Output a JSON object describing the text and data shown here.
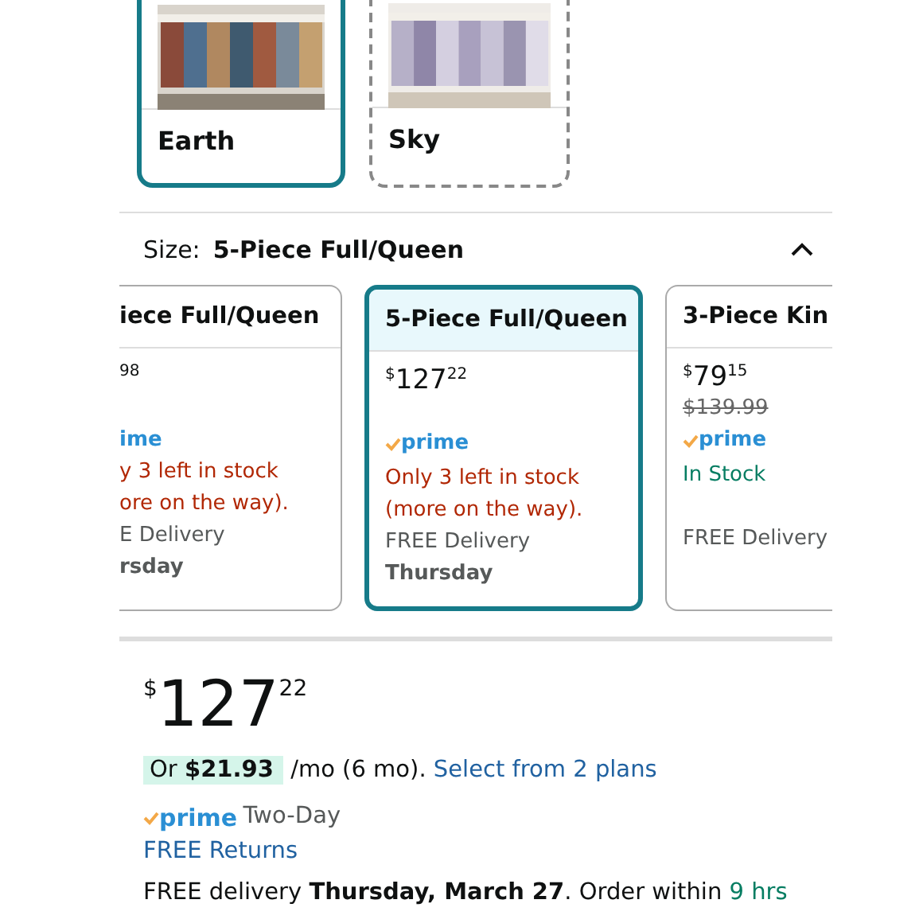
{
  "color_swatches": [
    {
      "label": "Earth",
      "selected": true,
      "available": true,
      "kind": "picture"
    },
    {
      "label": "Sky",
      "selected": false,
      "available": false,
      "kind": "picture"
    }
  ],
  "size": {
    "label": "Size:",
    "value": "5-Piece Full/Queen",
    "expanded": true
  },
  "size_options": [
    {
      "title": "iece Full/Queen",
      "price_fraction": "98",
      "prime": "ime",
      "prime_check": false,
      "stock": "y 3 left in stock",
      "stock_more": "ore on the way).",
      "in_stock": false,
      "delivery": "E Delivery",
      "delivery_day": "rsday",
      "selected": false
    },
    {
      "title": "5-Piece Full/Queen",
      "currency": "$",
      "price_whole": "127",
      "price_fraction": "22",
      "prime": "prime",
      "prime_check": true,
      "stock": "Only 3 left in stock",
      "stock_more": "(more on the way).",
      "in_stock": false,
      "delivery": "FREE Delivery",
      "delivery_day": "Thursday",
      "selected": true
    },
    {
      "title": "3-Piece Kin",
      "currency": "$",
      "price_whole": "79",
      "price_fraction": "15",
      "list_price": "$139.99",
      "prime": "prime",
      "prime_check": true,
      "stock": "In Stock",
      "in_stock": true,
      "delivery": "FREE Delivery",
      "selected": false
    }
  ],
  "summary": {
    "currency": "$",
    "price_whole": "127",
    "price_fraction": "22",
    "installment": "Or **$21.93**",
    "installment_terms": "/mo (6 mo).",
    "plans_link": "Select from 2 plans",
    "prime": "prime",
    "shipping": "Two-Day",
    "returns_link": "FREE Returns",
    "delivery": "FREE delivery **Thursday, March 27**. Order within ",
    "countdown": "9 hrs"
  }
}
